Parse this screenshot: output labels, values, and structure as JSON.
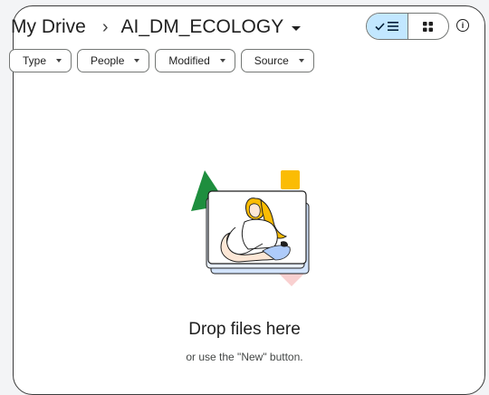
{
  "header": {
    "root": "My Drive",
    "separator": "›",
    "current_folder": "AI_DM_ECOLOGY"
  },
  "view_toggle": {
    "list_icon": "check-list-icon",
    "grid_icon": "grid-icon",
    "selected": "list",
    "active_color": "#c2e7ff"
  },
  "info": {
    "icon": "info-icon",
    "glyph": "i"
  },
  "filters": [
    {
      "label": "Type"
    },
    {
      "label": "People"
    },
    {
      "label": "Modified"
    },
    {
      "label": "Source"
    }
  ],
  "empty_state": {
    "title": "Drop files here",
    "subtitle": "or use the \"New\" button."
  },
  "colors": {
    "green": "#1e8e3e",
    "yellow": "#fbbc04",
    "pink": "#f9d0d0",
    "blue": "#aecbfa"
  }
}
